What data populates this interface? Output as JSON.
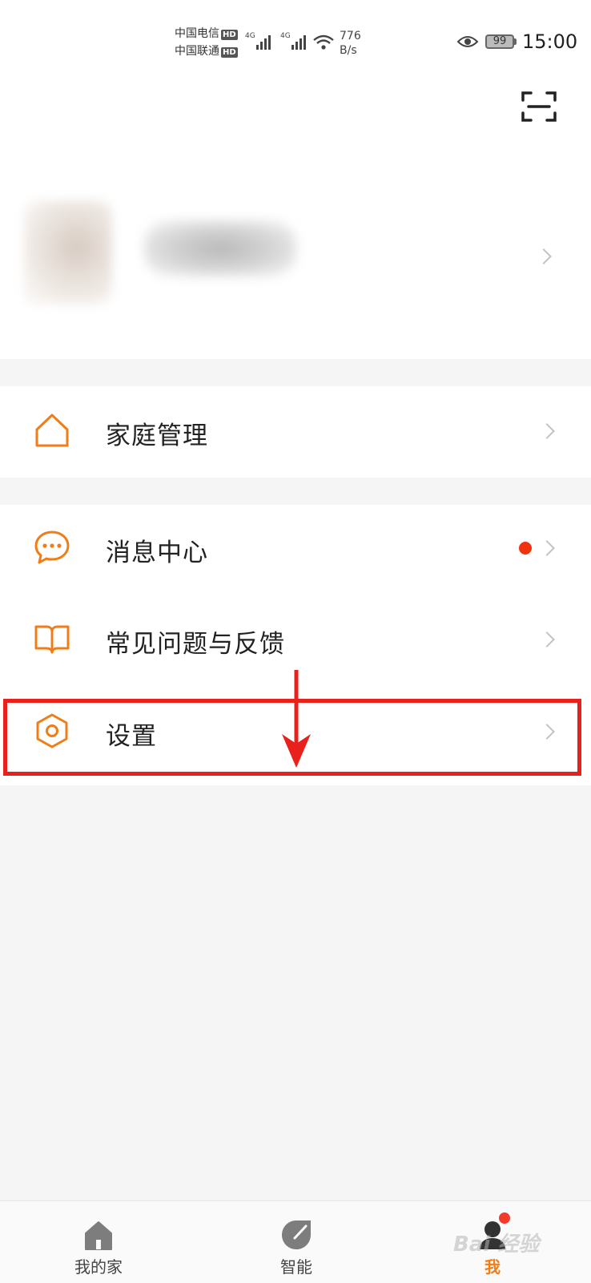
{
  "status_bar": {
    "carrier1": "中国电信",
    "carrier2": "中国联通",
    "hd_badge": "HD",
    "net_type": "4G",
    "net_speed_value": "776",
    "net_speed_unit": "B/s",
    "battery": "99",
    "time": "15:00"
  },
  "header": {
    "scan_icon": "scan-icon"
  },
  "menu": {
    "family": {
      "label": "家庭管理",
      "icon": "home-outline-icon"
    },
    "messages": {
      "label": "消息中心",
      "icon": "chat-bubble-icon",
      "has_unread": true
    },
    "faq": {
      "label": "常见问题与反馈",
      "icon": "open-book-icon"
    },
    "settings": {
      "label": "设置",
      "icon": "hexagon-settings-icon"
    }
  },
  "tabbar": {
    "tabs": [
      {
        "label": "我的家",
        "icon": "home-filled-icon",
        "active": false
      },
      {
        "label": "智能",
        "icon": "smart-leaf-icon",
        "active": false
      },
      {
        "label": "我",
        "icon": "user-icon",
        "active": true
      }
    ]
  },
  "colors": {
    "accent": "#f07d17",
    "highlight": "#e8211c",
    "badge": "#f0320f"
  },
  "watermark": "Bai 经验"
}
